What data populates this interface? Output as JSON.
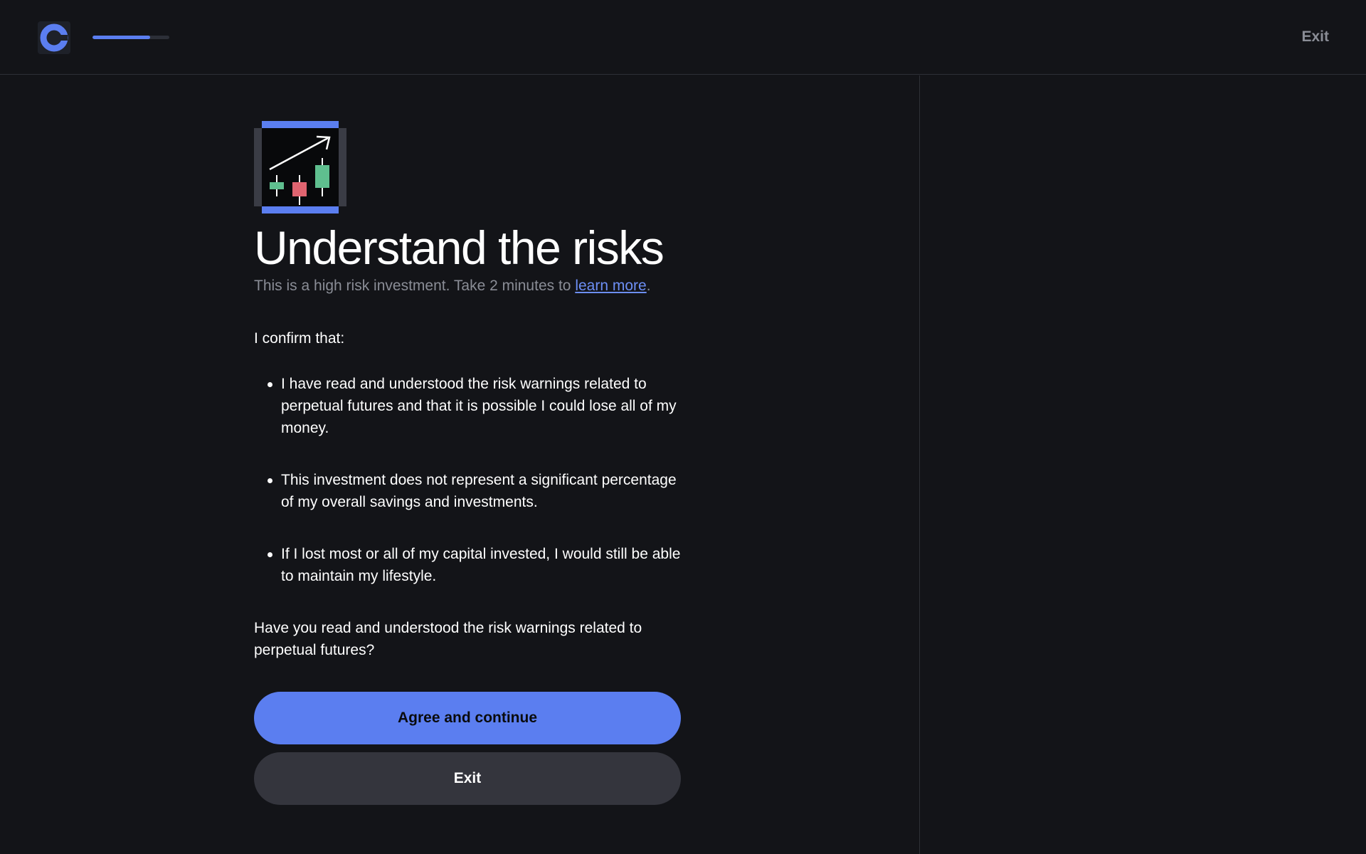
{
  "header": {
    "logo_icon": "coinbase-logo-icon",
    "progress": 0.75,
    "exit_label": "Exit"
  },
  "main": {
    "illustration_icon": "candlestick-chart-icon",
    "title": "Understand the risks",
    "subtitle_prefix": "This is a high risk investment. Take 2 minutes to ",
    "subtitle_link": "learn more",
    "subtitle_suffix": ".",
    "confirm_label": "I confirm that:",
    "bullets": [
      "I have read and understood the risk warnings related to perpetual futures and that it is possible I could lose all of my money.",
      "This investment does not represent a significant percentage of my overall savings and investments.",
      "If I lost most or all of my capital invested, I would still be able to maintain my lifestyle."
    ],
    "question": "Have you read and understood the risk warnings related to perpetual futures?",
    "primary_button": "Agree and continue",
    "secondary_button": "Exit"
  },
  "colors": {
    "background": "#131418",
    "accent": "#5b7ef0",
    "link": "#6d8ff5",
    "muted_text": "#8a8d96",
    "secondary_button": "#34353d",
    "candle_green": "#5fbf8f",
    "candle_red": "#e06470"
  }
}
